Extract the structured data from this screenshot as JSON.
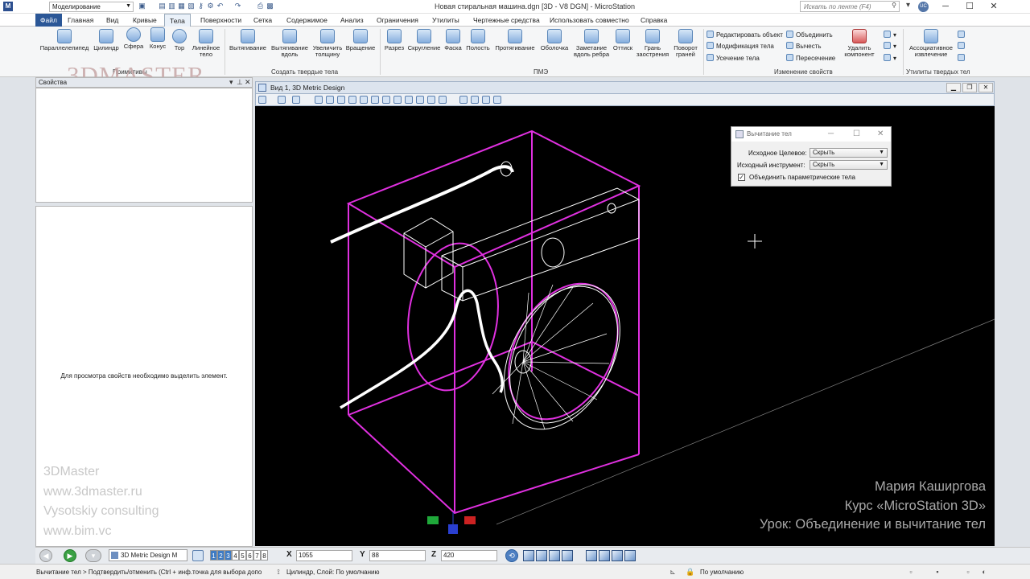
{
  "app": {
    "title": "Новая стиральная машина.dgn [3D - V8 DGN] - MicroStation",
    "workflow": "Моделирование",
    "search_placeholder": "Искать по ленте (F4)",
    "user_initials": "UC"
  },
  "tabs": [
    "Файл",
    "Главная",
    "Вид",
    "Кривые",
    "Тела",
    "Поверхности",
    "Сетка",
    "Содержимое",
    "Анализ",
    "Ограничения",
    "Утилиты",
    "Чертежные средства",
    "Использовать совместно",
    "Справка"
  ],
  "ribbon": {
    "primitives": {
      "label": "Примитивы",
      "buttons": [
        "Параллелепипед",
        "Цилиндр",
        "Сфера",
        "Конус",
        "Тор",
        "Линейное тело"
      ]
    },
    "create_solids": {
      "label": "Создать твердые тела",
      "buttons": [
        "Вытягивание",
        "Вытягивание вдоль",
        "Увеличить толщину",
        "Вращение"
      ]
    },
    "pmz": {
      "label": "ПМЭ",
      "buttons": [
        "Разрез",
        "Скругление",
        "Фаска",
        "Полость",
        "Протягивание",
        "Оболочка",
        "Заметание вдоль ребра",
        "Оттиск",
        "Грань заострения",
        "Поворот граней"
      ]
    },
    "modify": {
      "label": "Изменение свойств",
      "col1": [
        "Редактировать объект",
        "Модификация тела",
        "Усечение тела"
      ],
      "col2": [
        "Объединить",
        "Вычесть",
        "Пересечение"
      ],
      "delete_component": "Удалить компонент"
    },
    "utilities": {
      "label": "Утилиты твердых тел",
      "assoc": "Ассоциативное извлечение"
    }
  },
  "watermark": {
    "logo": "3DMASTER",
    "left_lines": [
      "3DMaster",
      "www.3dmaster.ru",
      "Vysotskiy consulting",
      "www.bim.vc"
    ],
    "right_lines": [
      "Мария Каширгова",
      "Курс «MicroStation 3D»",
      "Урок: Объединение и вычитание тел"
    ]
  },
  "properties": {
    "title": "Свойства",
    "empty_message": "Для просмотра свойств необходимо выделить элемент."
  },
  "view": {
    "title": "Вид 1, 3D Metric Design"
  },
  "dialog": {
    "title": "Вычитание тел",
    "target_label": "Исходное Целевое:",
    "target_value": "Скрыть",
    "tool_label": "Исходный инструмент:",
    "tool_value": "Скрыть",
    "checkbox_label": "Объединить параметрические тела",
    "checkbox_checked": true
  },
  "bottom": {
    "view_select": "3D Metric Design M",
    "view_numbers": [
      "1",
      "2",
      "3",
      "4",
      "5",
      "6",
      "7",
      "8"
    ],
    "active_views": [
      1,
      2,
      3
    ],
    "x_label": "X",
    "x_value": "1055",
    "y_label": "Y",
    "y_value": "88",
    "z_label": "Z",
    "z_value": "420"
  },
  "status": {
    "prompt": "Вычитание тел > Подтвердить/отменить (Ctrl + инф.точка для выбора допо",
    "message": "Цилиндр, Слой: По умолчанию",
    "level": "По умолчанию"
  },
  "colors": {
    "ribbon_bg": "#f5f6f7",
    "file_tab": "#2b5797",
    "viewport_bg": "#000000",
    "wire_magenta": "#e030e0",
    "wire_white": "#ffffff"
  }
}
